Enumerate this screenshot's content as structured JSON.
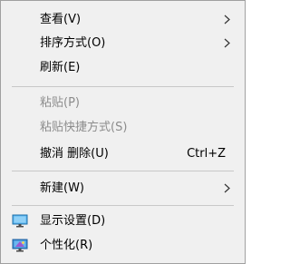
{
  "menu": {
    "items": [
      {
        "label": "查看(V)"
      },
      {
        "label": "排序方式(O)"
      },
      {
        "label": "刷新(E)"
      },
      {
        "label": "粘贴(P)"
      },
      {
        "label": "粘贴快捷方式(S)"
      },
      {
        "label": "撤消 删除(U)",
        "shortcut": "Ctrl+Z"
      },
      {
        "label": "新建(W)"
      },
      {
        "label": "显示设置(D)",
        "icon": "display-settings-icon"
      },
      {
        "label": "个性化(R)",
        "icon": "personalize-icon"
      }
    ]
  },
  "colors": {
    "menu_background": "#f0f0f0",
    "disabled_text": "#8c8c8c",
    "separator": "#c8c8c8",
    "border": "#a0a0a0"
  }
}
